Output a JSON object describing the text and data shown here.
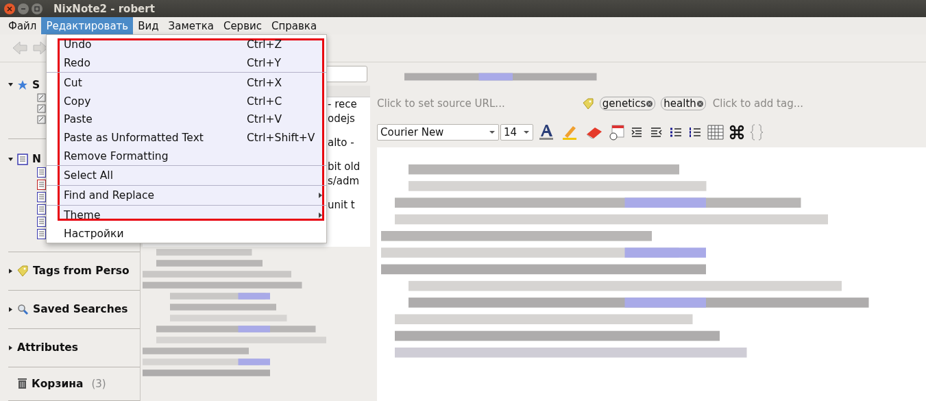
{
  "window": {
    "title": "NixNote2 - robert"
  },
  "menubar": [
    {
      "label": "Файл",
      "selected": false
    },
    {
      "label": "Редактировать",
      "selected": true
    },
    {
      "label": "Вид",
      "selected": false
    },
    {
      "label": "Заметка",
      "selected": false
    },
    {
      "label": "Сервис",
      "selected": false
    },
    {
      "label": "Справка",
      "selected": false
    }
  ],
  "edit_menu": {
    "highlighted": true,
    "items": [
      {
        "kind": "item",
        "label": "Undo",
        "shortcut": "Ctrl+Z",
        "submenu": false
      },
      {
        "kind": "item",
        "label": "Redo",
        "shortcut": "Ctrl+Y",
        "submenu": false
      },
      {
        "kind": "separator"
      },
      {
        "kind": "item",
        "label": "Cut",
        "shortcut": "Ctrl+X",
        "submenu": false
      },
      {
        "kind": "item",
        "label": "Copy",
        "shortcut": "Ctrl+C",
        "submenu": false
      },
      {
        "kind": "item",
        "label": "Paste",
        "shortcut": "Ctrl+V",
        "submenu": false
      },
      {
        "kind": "item",
        "label": "Paste as Unformatted Text",
        "shortcut": "Ctrl+Shift+V",
        "submenu": false
      },
      {
        "kind": "item",
        "label": "Remove Formatting",
        "submenu": false
      },
      {
        "kind": "separator"
      },
      {
        "kind": "item",
        "label": "Select All",
        "submenu": false
      },
      {
        "kind": "separator"
      },
      {
        "kind": "item",
        "label": "Find and Replace",
        "submenu": true
      },
      {
        "kind": "separator"
      },
      {
        "kind": "item",
        "label": "Theme",
        "submenu": true
      },
      {
        "kind": "item",
        "label": "Настройки",
        "submenu": false
      }
    ]
  },
  "sidebar": {
    "sections": [
      {
        "kind": "shortcuts",
        "label": "S",
        "expanded": true,
        "children": [
          {
            "kind": "shortcut"
          },
          {
            "kind": "shortcut"
          },
          {
            "kind": "shortcut"
          }
        ]
      },
      {
        "kind": "notebooks",
        "label": "N",
        "expanded": true,
        "children": [
          {
            "kind": "notebook"
          },
          {
            "kind": "notebook-deleted"
          },
          {
            "kind": "notebook"
          },
          {
            "kind": "notebook"
          },
          {
            "kind": "notebook"
          },
          {
            "kind": "notebook-shared"
          }
        ]
      },
      {
        "kind": "tags",
        "label": "Tags from Perso",
        "expanded": false
      },
      {
        "kind": "searches",
        "label": "Saved Searches",
        "expanded": false
      },
      {
        "kind": "attributes",
        "label": "Attributes",
        "expanded": false
      },
      {
        "kind": "trash",
        "label": "Корзина",
        "count": "(3)"
      }
    ]
  },
  "note_list": {
    "groups": [
      {
        "lines": [
          "- rece",
          "odejs"
        ]
      },
      {
        "lines": [
          "alto - "
        ]
      },
      {
        "lines": [
          "bit old",
          "s/adm"
        ]
      },
      {
        "lines": [
          "unit t"
        ]
      }
    ]
  },
  "editor": {
    "source_url": {
      "placeholder": "Click to set source URL..."
    },
    "tags": [
      {
        "label": "genetics"
      },
      {
        "label": "health"
      }
    ],
    "add_tag": {
      "placeholder": "Click to add tag..."
    },
    "font": "Courier New",
    "size": "14"
  }
}
